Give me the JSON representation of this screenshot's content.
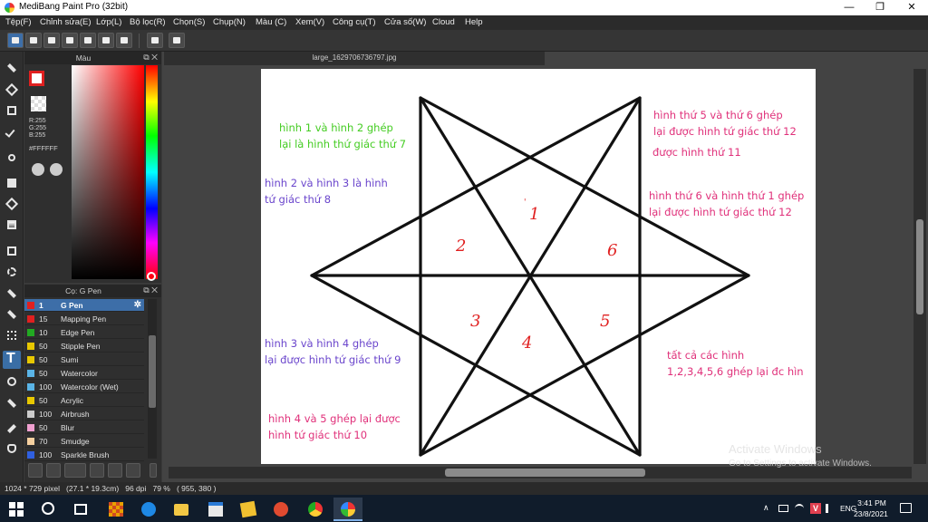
{
  "window": {
    "title": "MediBang Paint Pro (32bit)",
    "minimize": "—",
    "maximize": "❐",
    "close": "✕"
  },
  "menu": [
    "Tệp(F)",
    "Chỉnh sửa(E)",
    "Lớp(L)",
    "Bộ lọc(R)",
    "Chọn(S)",
    "Chụp(N)",
    "Màu (C)",
    "Xem(V)",
    "Công cụ(T)",
    "Cửa số(W)",
    "Cloud",
    "Help"
  ],
  "color_panel": {
    "title": "Màu",
    "rgb": [
      "R:255",
      "G:255",
      "B:255"
    ],
    "hex": "#FFFFFF",
    "fg_color": "#e02020",
    "bg_color": "#ffffff"
  },
  "brush_panel": {
    "title": "Cọ: G Pen",
    "brushes": [
      {
        "size": "1",
        "name": "G Pen",
        "color": "#e02020",
        "selected": true
      },
      {
        "size": "15",
        "name": "Mapping Pen",
        "color": "#e02020"
      },
      {
        "size": "10",
        "name": "Edge Pen",
        "color": "#22aa22"
      },
      {
        "size": "50",
        "name": "Stipple Pen",
        "color": "#e8c800"
      },
      {
        "size": "50",
        "name": "Sumi",
        "color": "#e8c800"
      },
      {
        "size": "50",
        "name": "Watercolor",
        "color": "#5ab4e6"
      },
      {
        "size": "100",
        "name": "Watercolor (Wet)",
        "color": "#5ab4e6"
      },
      {
        "size": "50",
        "name": "Acrylic",
        "color": "#e8c800"
      },
      {
        "size": "100",
        "name": "Airbrush",
        "color": "#cccccc"
      },
      {
        "size": "50",
        "name": "Blur",
        "color": "#f0a0d0"
      },
      {
        "size": "70",
        "name": "Smudge",
        "color": "#f5d0a0"
      },
      {
        "size": "100",
        "name": "Sparkle Brush",
        "color": "#3060e0"
      }
    ]
  },
  "document": {
    "tab_title": "large_1629706736797.jpg"
  },
  "drawing": {
    "region_numbers": [
      "1",
      "2",
      "3",
      "4",
      "5",
      "6"
    ],
    "annotations": [
      {
        "text": "hình 1 và hình 2 ghép\nlại là hình thứ giác thứ 7",
        "color": "#44cc22"
      },
      {
        "text": "hình 2 và hình 3 là hình\ntứ giác thứ 8",
        "color": "#6a45cc"
      },
      {
        "text": "hình 3 và hình 4 ghép\nlại được hình tứ giác thứ 9",
        "color": "#6a45cc"
      },
      {
        "text": "hình 4 và 5 ghép lại được\nhình tứ giác thứ 10",
        "color": "#e0307a"
      },
      {
        "text": "hình thứ 5 và thứ 6 ghép\nlại được hình tứ giác thứ 12",
        "color": "#e0307a"
      },
      {
        "text": "được hình thứ 11",
        "color": "#e0307a"
      },
      {
        "text": "hình thứ 6 và hình thứ 1 ghép\nlại được hình tứ giác thứ 12",
        "color": "#e0307a"
      },
      {
        "text": "tất cả các hình\n1,2,3,4,5,6 ghép lại đc hìn",
        "color": "#e0307a"
      }
    ]
  },
  "watermark": {
    "line1": "Activate Windows",
    "line2": "Go to Settings to activate Windows."
  },
  "status": "1024 * 729 pixel   (27.1 * 19.3cm)   96 dpi   79 %   ( 955, 380 )",
  "taskbar": {
    "language": "ENG",
    "time": "3:41 PM",
    "date": "23/8/2021"
  }
}
